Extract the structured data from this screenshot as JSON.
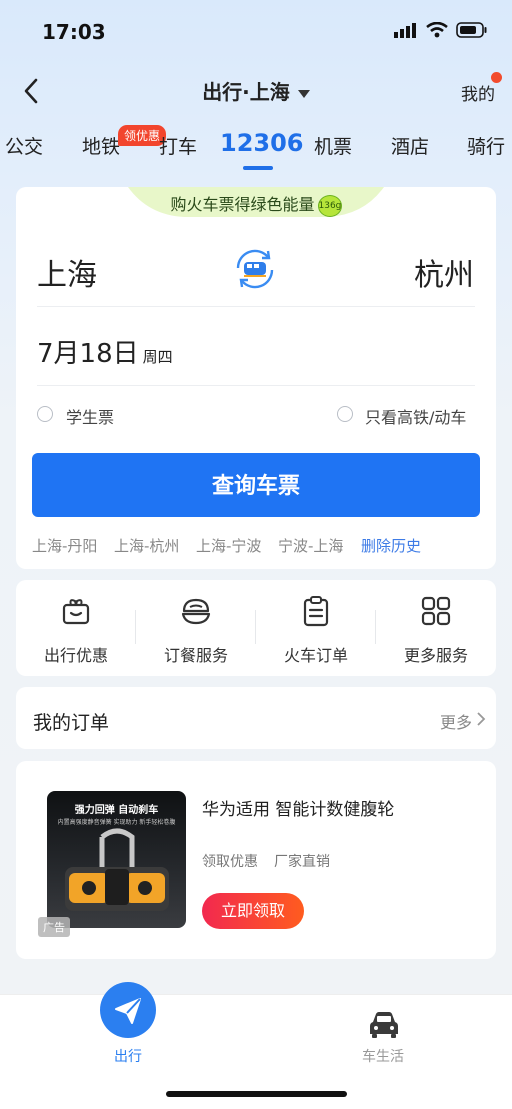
{
  "status": {
    "time": "17:03"
  },
  "nav": {
    "title": "出行·上海",
    "mine": "我的"
  },
  "tabs": [
    {
      "label": "公交"
    },
    {
      "label": "地铁"
    },
    {
      "label": "打车"
    },
    {
      "label": "12306"
    },
    {
      "label": "机票"
    },
    {
      "label": "酒店"
    },
    {
      "label": "骑行"
    }
  ],
  "tab_badge": "领优惠",
  "promo": {
    "text": "购火车票得绿色能量",
    "energy": "136g"
  },
  "ticket": {
    "from": "上海",
    "to": "杭州",
    "date": "7月18日",
    "weekday": "周四",
    "option_student": "学生票",
    "option_highspeed": "只看高铁/动车",
    "search_label": "查询车票",
    "history": [
      "上海-丹阳",
      "上海-杭州",
      "上海-宁波",
      "宁波-上海"
    ],
    "clear_history": "删除历史"
  },
  "services": [
    {
      "label": "出行优惠",
      "icon": "gift-icon"
    },
    {
      "label": "订餐服务",
      "icon": "food-bowl-icon"
    },
    {
      "label": "火车订单",
      "icon": "clipboard-icon"
    },
    {
      "label": "更多服务",
      "icon": "grid-icon"
    }
  ],
  "orders": {
    "title": "我的订单",
    "more": "更多"
  },
  "ad": {
    "image_title": "强力回弹 自动刹车",
    "image_sub": "内置高强度静音弹簧 实现助力 新手轻松卷腹",
    "tag": "广告",
    "title": "华为适用 智能计数健腹轮",
    "tags": [
      "领取优惠",
      "厂家直销"
    ],
    "button": "立即领取"
  },
  "bottom_nav": [
    {
      "label": "出行",
      "icon": "send-icon"
    },
    {
      "label": "车生活",
      "icon": "car-icon"
    }
  ],
  "colors": {
    "accent": "#1f74f3",
    "badge": "#f2452d",
    "ad_button": "#f2294f"
  }
}
